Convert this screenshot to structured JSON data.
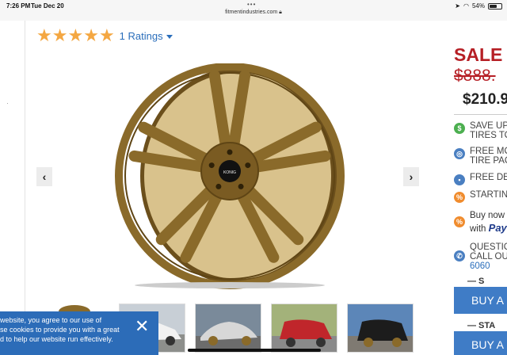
{
  "status_bar": {
    "time": "7:26 PM",
    "date": "Tue Dec 20",
    "url": "fitmentindustries.com",
    "battery": "54%",
    "battery_level": 0.54
  },
  "rating": {
    "stars": 5,
    "count_label": "1 Ratings"
  },
  "gallery": {
    "wheel_brand": "KONIG",
    "thumbnails": [
      {
        "name": "white-car"
      },
      {
        "name": "silver-coupe"
      },
      {
        "name": "red-hatchback"
      },
      {
        "name": "black-hatchback"
      }
    ]
  },
  "pricing": {
    "sale_label": "SALE",
    "old_price": "$888.",
    "new_price": "$210.9"
  },
  "perks": [
    {
      "icon": "dollar-icon",
      "line1": "SAVE UP",
      "line2": "TIRES TO",
      "color": "#4caf50"
    },
    {
      "icon": "tire-package-icon",
      "line1": "FREE MO",
      "line2": "TIRE PAC",
      "color": "#4a7fc1"
    },
    {
      "icon": "truck-icon",
      "line1": "FREE DE",
      "line2": "",
      "color": "#4a7fc1"
    },
    {
      "icon": "tag-icon",
      "line1": "STARTIN",
      "line2": "",
      "color": "#f08c2e"
    },
    {
      "icon": "paypal-tag-icon",
      "line1": "Buy now",
      "line2_prefix": "with ",
      "line2_brand": "Pay",
      "color": "#f08c2e"
    },
    {
      "icon": "phone-icon",
      "line1": "QUESTIC",
      "line2": "CALL OU",
      "line3": "6060",
      "color": "#4a7fc1"
    }
  ],
  "purchase": {
    "section1_label": "— S",
    "buy_label_1": "BUY A",
    "section2_label": "— STA",
    "buy_label_2": "BUY A"
  },
  "cookie_banner": {
    "line1": "website, you agree to our use of",
    "line2": "se cookies to provide you with a great",
    "line3": "d to help our website run effectively."
  },
  "colors": {
    "accent_blue": "#3f7cc6",
    "sale_red": "#b61f25",
    "star_gold": "#f4a742",
    "wheel_bronze": "#8a6a2a"
  }
}
